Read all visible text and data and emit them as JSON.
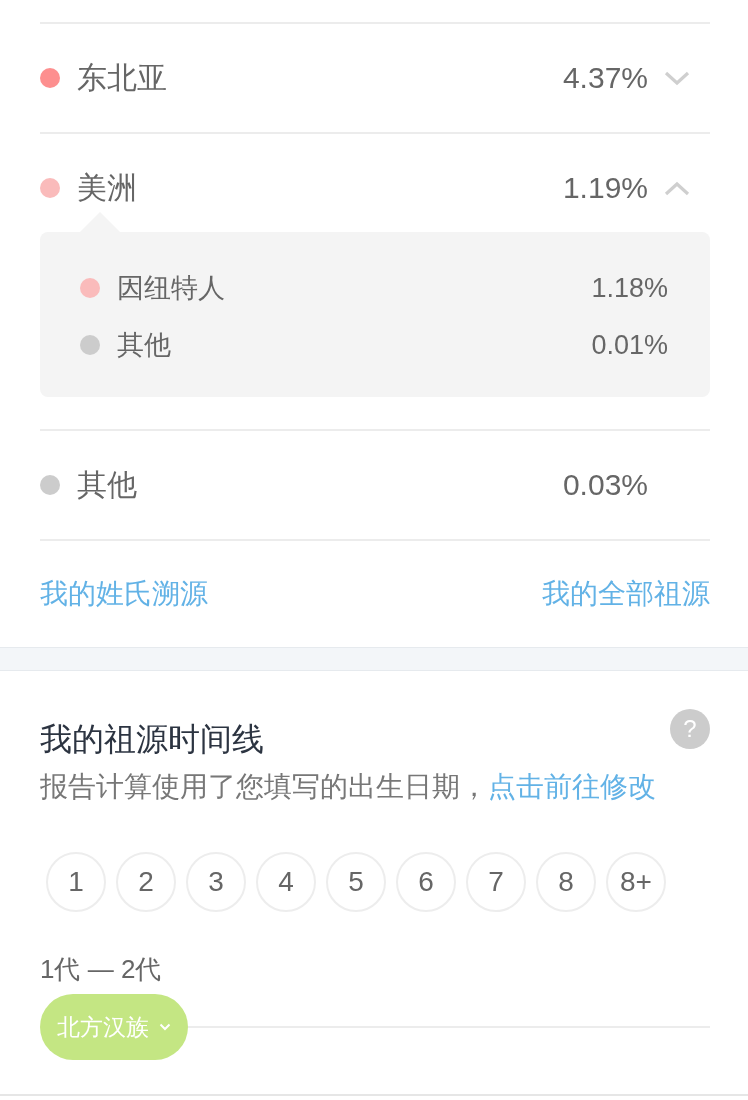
{
  "regions": [
    {
      "name": "东北亚",
      "share": "4.37%",
      "color": "#fd8f8f",
      "expanded": false
    },
    {
      "name": "美洲",
      "share": "1.19%",
      "color": "#fabbbb",
      "expanded": true,
      "children": [
        {
          "name": "因纽特人",
          "share": "1.18%",
          "color": "#fabbbb"
        },
        {
          "name": "其他",
          "share": "0.01%",
          "color": "#cccccc"
        }
      ]
    },
    {
      "name": "其他",
      "share": "0.03%",
      "color": "#cccccc"
    }
  ],
  "links": [
    "我的姓氏溯源",
    "我的全部祖源"
  ],
  "timeline": {
    "title": "我的祖源时间线",
    "help": "?",
    "note": "报告计算使用了您填写的出生日期，",
    "note_link": "点击前往修改",
    "generations": [
      {
        "label": "1",
        "selected": false
      },
      {
        "label": "2",
        "selected": false
      },
      {
        "label": "3",
        "selected": false
      },
      {
        "label": "4",
        "selected": false
      },
      {
        "label": "5",
        "selected": false
      },
      {
        "label": "6",
        "selected": false
      },
      {
        "label": "7",
        "selected": false
      },
      {
        "label": "8",
        "selected": false
      },
      {
        "label": "8+",
        "selected": false
      }
    ],
    "entries": [
      {
        "range": "1代 — 2代",
        "group": "北方汉族",
        "color": "#c4e683"
      }
    ]
  }
}
